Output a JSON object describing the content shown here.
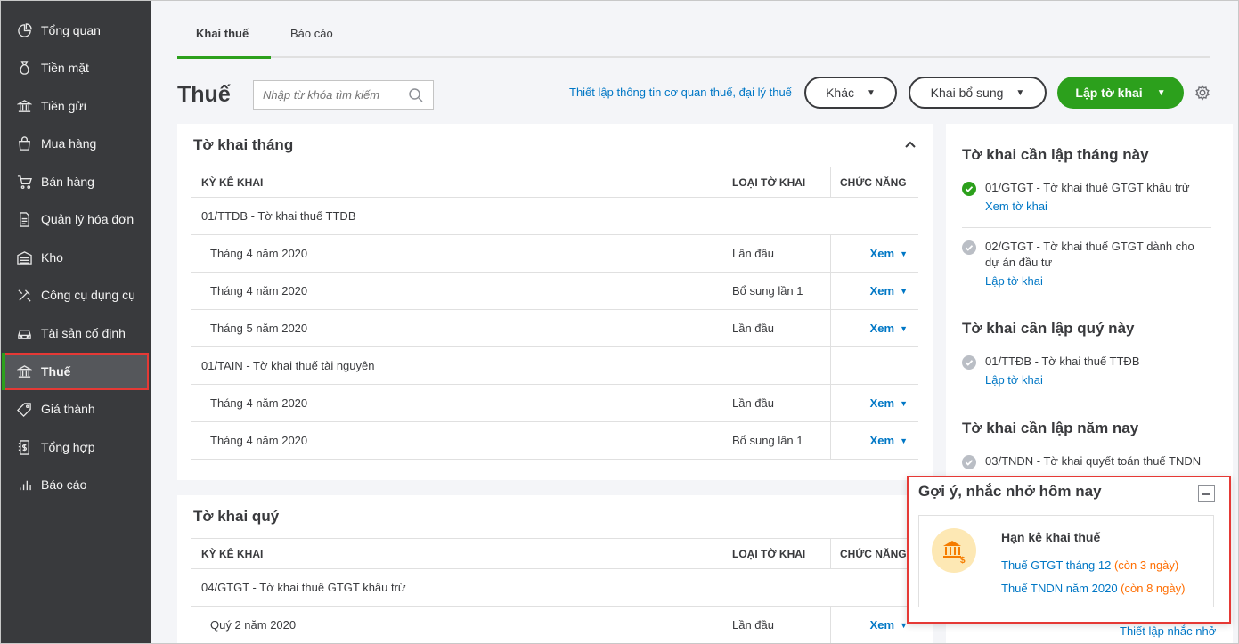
{
  "sidebar": {
    "items": [
      {
        "label": "Tổng quan",
        "icon": "dashboard-icon"
      },
      {
        "label": "Tiền mặt",
        "icon": "cash-bag-icon"
      },
      {
        "label": "Tiền gửi",
        "icon": "bank-icon"
      },
      {
        "label": "Mua hàng",
        "icon": "shopping-bag-icon"
      },
      {
        "label": "Bán hàng",
        "icon": "cart-icon"
      },
      {
        "label": "Quản lý hóa đơn",
        "icon": "invoice-icon"
      },
      {
        "label": "Kho",
        "icon": "warehouse-icon"
      },
      {
        "label": "Công cụ dụng cụ",
        "icon": "tools-icon"
      },
      {
        "label": "Tài sản cố định",
        "icon": "car-icon"
      },
      {
        "label": "Thuế",
        "icon": "tax-bank-icon"
      },
      {
        "label": "Giá thành",
        "icon": "price-tag-icon"
      },
      {
        "label": "Tổng hợp",
        "icon": "summary-doc-icon"
      },
      {
        "label": "Báo cáo",
        "icon": "bar-chart-icon"
      }
    ],
    "active_index": 9
  },
  "tabs": [
    {
      "label": "Khai thuế"
    },
    {
      "label": "Báo cáo"
    }
  ],
  "header": {
    "title": "Thuế",
    "search_placeholder": "Nhập từ khóa tìm kiếm",
    "setup_link": "Thiết lập thông tin cơ quan thuế, đại lý thuế",
    "other_button": "Khác",
    "supplement_button": "Khai bổ sung",
    "create_button": "Lập tờ khai"
  },
  "monthly": {
    "title": "Tờ khai tháng",
    "columns": [
      "KỲ KÊ KHAI",
      "LOẠI TỜ KHAI",
      "CHỨC NĂNG"
    ],
    "rows": [
      {
        "type": "group",
        "period": "01/TTĐB - Tờ khai thuế TTĐB"
      },
      {
        "type": "sub",
        "period": "Tháng 4 năm 2020",
        "kind": "Lần đầu",
        "action": "Xem"
      },
      {
        "type": "sub",
        "period": "Tháng 4 năm 2020",
        "kind": "Bổ sung lần 1",
        "action": "Xem"
      },
      {
        "type": "sub",
        "period": "Tháng 5 năm 2020",
        "kind": "Lần đầu",
        "action": "Xem"
      },
      {
        "type": "group",
        "period": "01/TAIN - Tờ khai thuế tài nguyên"
      },
      {
        "type": "sub",
        "period": "Tháng 4 năm 2020",
        "kind": "Lần đầu",
        "action": "Xem"
      },
      {
        "type": "sub",
        "period": "Tháng 4 năm 2020",
        "kind": "Bổ sung lần 1",
        "action": "Xem"
      }
    ]
  },
  "quarterly": {
    "title": "Tờ khai quý",
    "columns": [
      "KỲ KÊ KHAI",
      "LOẠI TỜ KHAI",
      "CHỨC NĂNG"
    ],
    "rows": [
      {
        "type": "group",
        "period": "04/GTGT - Tờ khai thuế GTGT khấu trừ"
      },
      {
        "type": "sub",
        "period": "Quý 2 năm 2020",
        "kind": "Lần đầu",
        "action": "Xem"
      }
    ]
  },
  "right_panel": {
    "month_title": "Tờ khai cần lập tháng này",
    "month_items": [
      {
        "text": "01/GTGT - Tờ khai thuế GTGT khấu trừ",
        "link": "Xem tờ khai",
        "status": "done",
        "status_color": "#2ca01c"
      },
      {
        "text": "02/GTGT - Tờ khai thuế GTGT dành cho dự án đầu tư",
        "link": "Lập tờ khai",
        "status": "pending",
        "status_color": "#babec5"
      }
    ],
    "quarter_title": "Tờ khai cần lập quý này",
    "quarter_items": [
      {
        "text": "01/TTĐB - Tờ khai thuế TTĐB",
        "link": "Lập tờ khai",
        "status": "pending"
      }
    ],
    "year_title": "Tờ khai cần lập năm nay",
    "year_items": [
      {
        "text": "03/TNDN - Tờ khai quyết toán thuế TNDN",
        "status": "pending"
      }
    ]
  },
  "reminder": {
    "title": "Gợi ý, nhắc nhở hôm nay",
    "heading": "Hạn kê khai thuế",
    "items": [
      {
        "text": "Thuế GTGT tháng 12",
        "remaining": "(còn 3 ngày)"
      },
      {
        "text": "Thuế TNDN năm 2020",
        "remaining": "(còn 8 ngày)"
      }
    ],
    "footer_link": "Thiết lập nhắc nhở"
  },
  "colors": {
    "sidebar_bg": "#393a3d",
    "accent_green": "#2ca01c",
    "link_blue": "#0077c5",
    "warning_orange": "#ff6d00",
    "highlight_red": "#e53935"
  }
}
